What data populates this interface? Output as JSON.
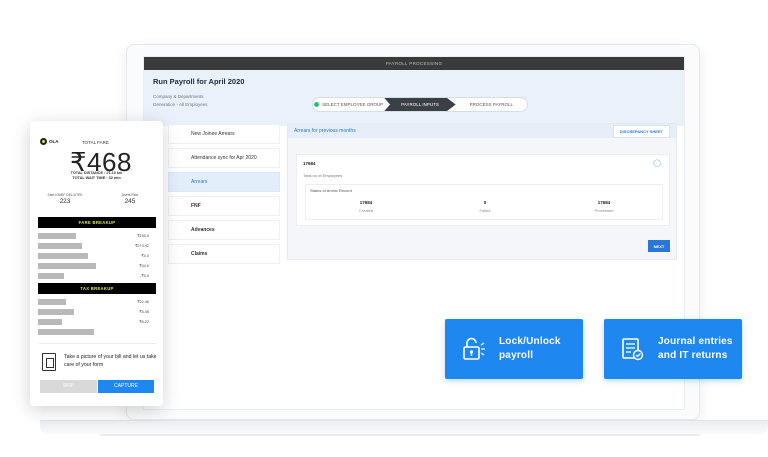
{
  "app": {
    "topbar_title": "PAYROLL PROCESSING",
    "page_title": "Run Payroll for April 2020",
    "company_label": "Company & Departments",
    "company_value": "Generation - All Employees"
  },
  "stepper": [
    {
      "label": "SELECT EMPLOYEE GROUP",
      "state": "done"
    },
    {
      "label": "PAYROLL INPUTS",
      "state": "active"
    },
    {
      "label": "PROCESS PAYROLL",
      "state": "pending"
    }
  ],
  "sidenav": [
    {
      "label": "New Joinee Arrears"
    },
    {
      "label": "Attendance sync for Apr 2020"
    },
    {
      "label": "Arrears"
    },
    {
      "label": "FNF"
    },
    {
      "label": "Advances"
    },
    {
      "label": "Claims"
    }
  ],
  "panel": {
    "title": "Arrears for previous months",
    "discrepancy_btn": "DISCREPANCY SHEET",
    "card_id": "17684",
    "card_sub": "Total no of Employees",
    "status_title": "Status of Arrear Record",
    "stats": [
      {
        "value": "17684",
        "label": "Created"
      },
      {
        "value": "0",
        "label": "Failed"
      },
      {
        "value": "17684",
        "label": "Processed"
      }
    ],
    "next_btn": "NEXT"
  },
  "features": [
    {
      "line1": "Lock/Unlock",
      "line2": "payroll",
      "icon": "lock-icon"
    },
    {
      "line1": "Journal entries",
      "line2": "and IT returns",
      "icon": "document-icon"
    }
  ],
  "receipt": {
    "brand": "OLA",
    "total_label": "TOTAL FARE",
    "amount": "₹468",
    "distance": "TOTAL DISTANCE : 21.10 km",
    "wait": "TOTAL WAIT TIME : 32 min",
    "mini": [
      {
        "label": "Start KM/BF DEL/UTEE",
        "value": "223"
      },
      {
        "label": "Users Ride",
        "value": "245"
      }
    ],
    "fare_breakup_title": "FARE BREAKUP",
    "fare_rows": [
      "₹150.0",
      "₹273.42",
      "₹0.0",
      "₹44.0",
      "-₹0.0"
    ],
    "tax_breakup_title": "TAX BREAKUP",
    "tax_rows": [
      "₹22.46",
      "₹5.45",
      "₹6.22"
    ],
    "bill_text": "Take a picture of your bill and let us take care of your form",
    "skip_btn": "SKIP",
    "capture_btn": "CAPTURE"
  },
  "colors": {
    "accent": "#1e88f0",
    "header_bg": "#e9f1fb",
    "receipt_bar": "#000000",
    "receipt_bar_text": "#d7ef5a"
  }
}
